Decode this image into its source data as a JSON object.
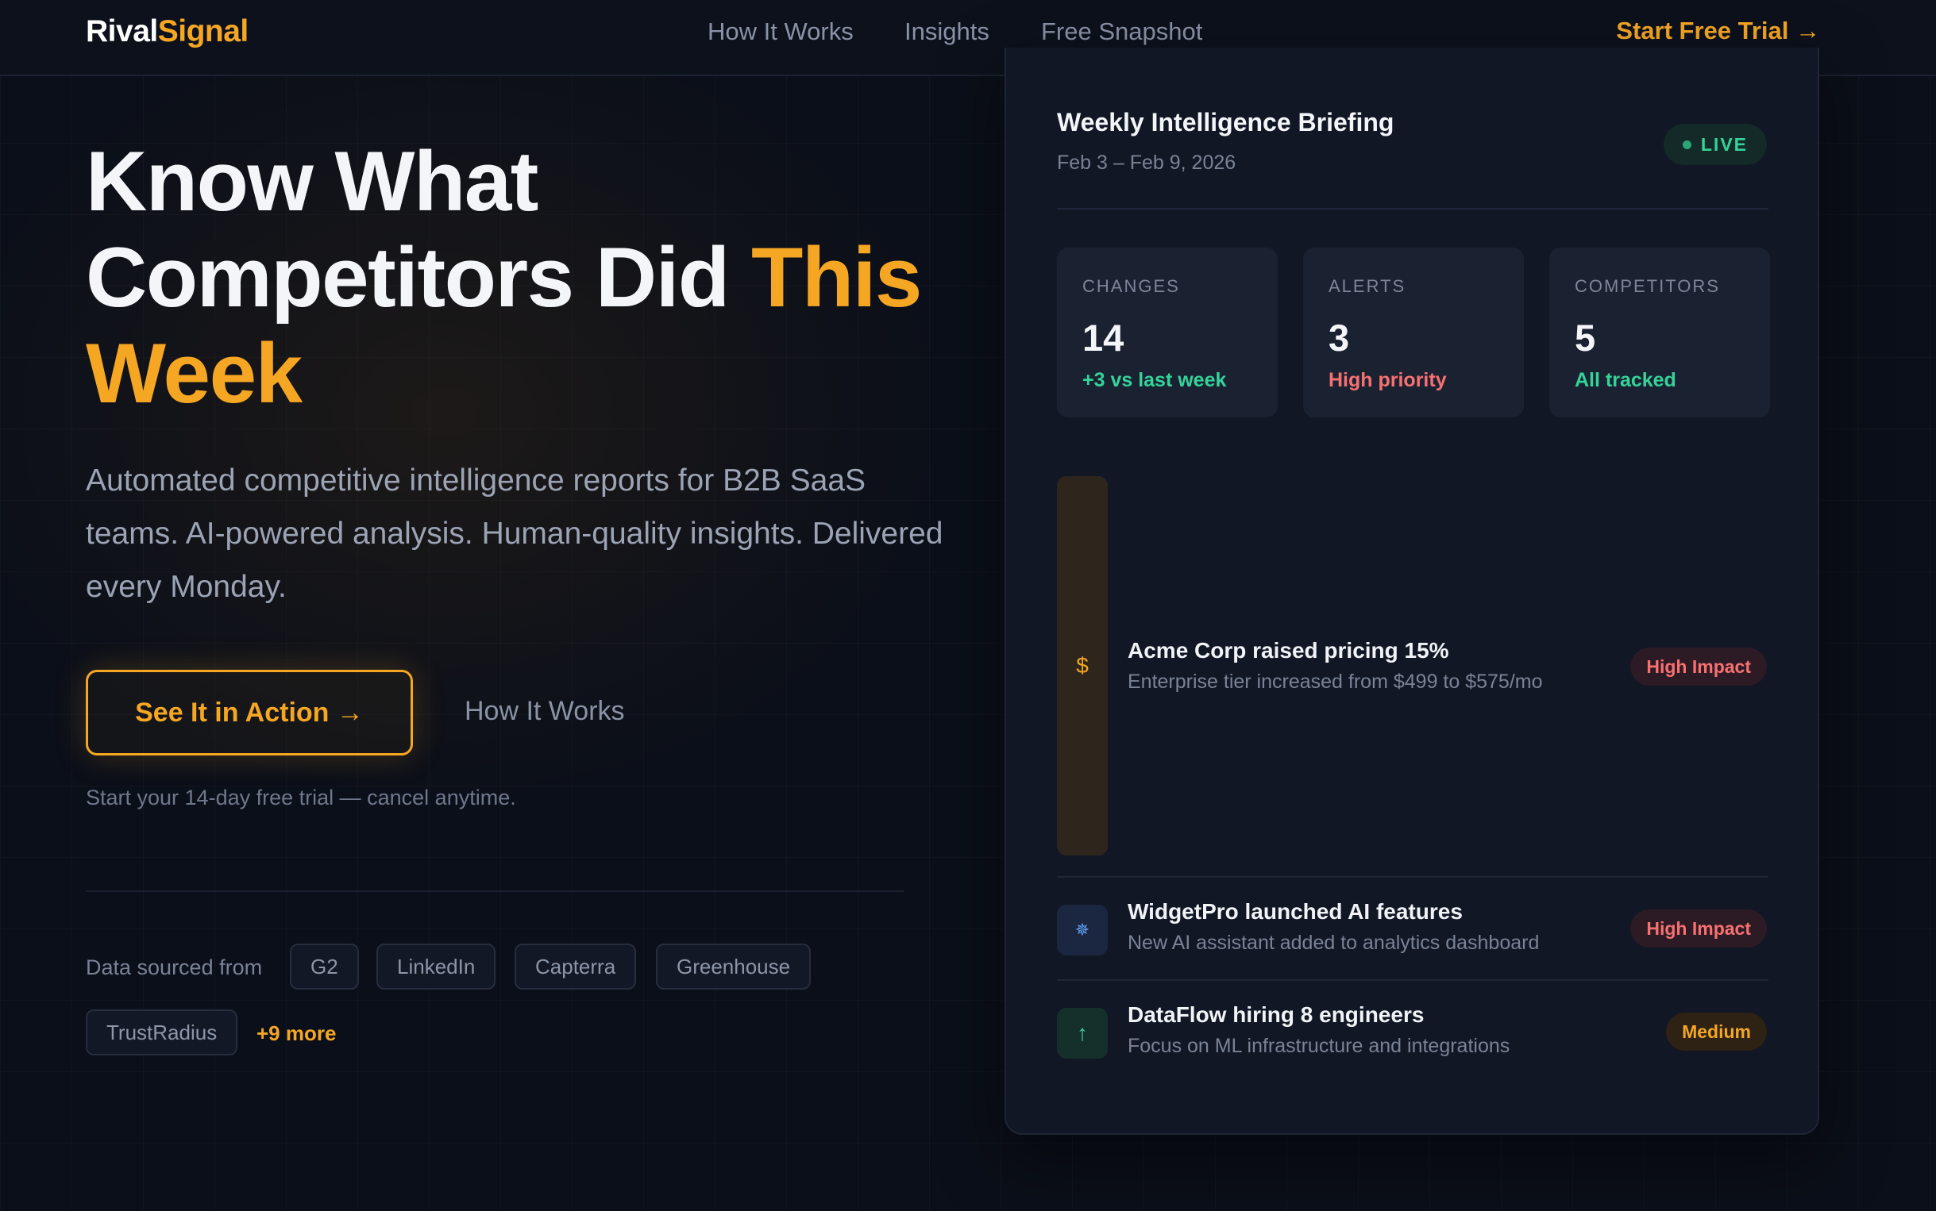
{
  "nav": {
    "logo_part1": "Rival",
    "logo_part2": "Signal",
    "links": [
      "How It Works",
      "Insights",
      "Free Snapshot"
    ],
    "cta": "Start Free Trial →"
  },
  "hero": {
    "title_line1": "Know What",
    "title_line2_a": "Competitors Did ",
    "title_line2_b": "This",
    "title_line3": "Week",
    "subtitle": "Automated competitive intelligence reports for B2B SaaS teams. AI-powered analysis. Human-quality insights. Delivered every Monday.",
    "primary_button": "See It in Action →",
    "secondary_button": "How It Works",
    "trial_note": "Start your 14-day free trial — cancel anytime.",
    "sources_label": "Data sourced from",
    "sources": [
      "G2",
      "LinkedIn",
      "Capterra",
      "Greenhouse",
      "TrustRadius"
    ],
    "more_sources": "+9 more"
  },
  "briefing": {
    "title": "Weekly Intelligence Briefing",
    "date_range": "Feb 3 – Feb 9, 2026",
    "live_label": "LIVE",
    "stats": [
      {
        "label": "CHANGES",
        "value": "14",
        "note": "+3 vs last week",
        "note_color": "#34d399"
      },
      {
        "label": "ALERTS",
        "value": "3",
        "note": "High priority",
        "note_color": "#f87171"
      },
      {
        "label": "COMPETITORS",
        "value": "5",
        "note": "All tracked",
        "note_color": "#34d399"
      }
    ],
    "items": [
      {
        "icon": "dollar-icon",
        "glyph": "$",
        "title": "Acme Corp raised pricing 15%",
        "desc": "Enterprise tier increased from $499 to $575/mo",
        "badge": "High Impact"
      },
      {
        "icon": "sparkle-icon",
        "glyph": "✵",
        "title": "WidgetPro launched AI features",
        "desc": "New AI assistant added to analytics dashboard",
        "badge": "High Impact"
      },
      {
        "icon": "arrow-up-icon",
        "glyph": "↑",
        "title": "DataFlow hiring 8 engineers",
        "desc": "Focus on ML infrastructure and integrations",
        "badge": "Medium"
      }
    ]
  },
  "colors": {
    "accent": "#f5a623",
    "background": "#0b0f19",
    "success": "#34d399",
    "danger": "#f87171"
  }
}
